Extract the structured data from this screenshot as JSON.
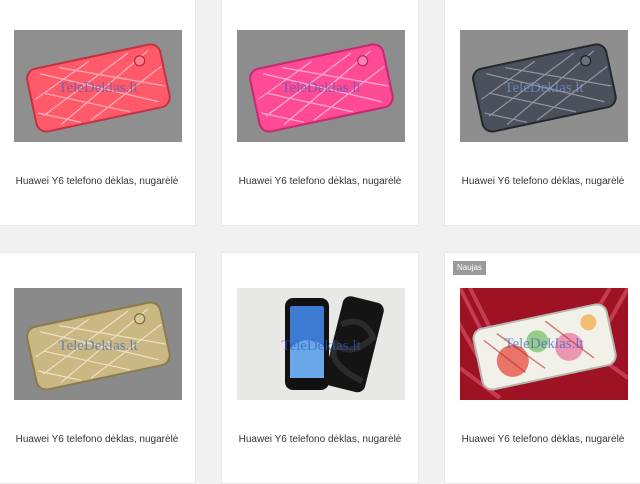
{
  "products": [
    {
      "title": "Huawei Y6 telefono dėklas, nugarėlė",
      "watermark": "TeleDeklas.lt",
      "case_color": "#ff5a6a",
      "style": "quilted"
    },
    {
      "title": "Huawei Y6 telefono dėklas, nugarėlė",
      "watermark": "TeleDeklas.lt",
      "case_color": "#ff4a96",
      "style": "quilted"
    },
    {
      "title": "Huawei Y6 telefono dėklas, nugarėlė",
      "watermark": "TeleDeklas.lt",
      "case_color": "#4a505c",
      "style": "quilted"
    },
    {
      "title": "Huawei Y6 telefono dėklas, nugarėlė",
      "watermark": "TeleDeklas.lt",
      "case_color": "#c9b784",
      "style": "quilted"
    },
    {
      "title": "Huawei Y6 telefono dėklas, nugarėlė",
      "watermark": "TeleDeklas.lt",
      "case_color": "#111111",
      "style": "s-line"
    },
    {
      "title": "Huawei Y6 telefono dėklas, nugarėlė",
      "watermark": "TeleDeklas.lt",
      "case_color": "#f1f1ea",
      "style": "floral",
      "badge": "Naujas"
    }
  ]
}
